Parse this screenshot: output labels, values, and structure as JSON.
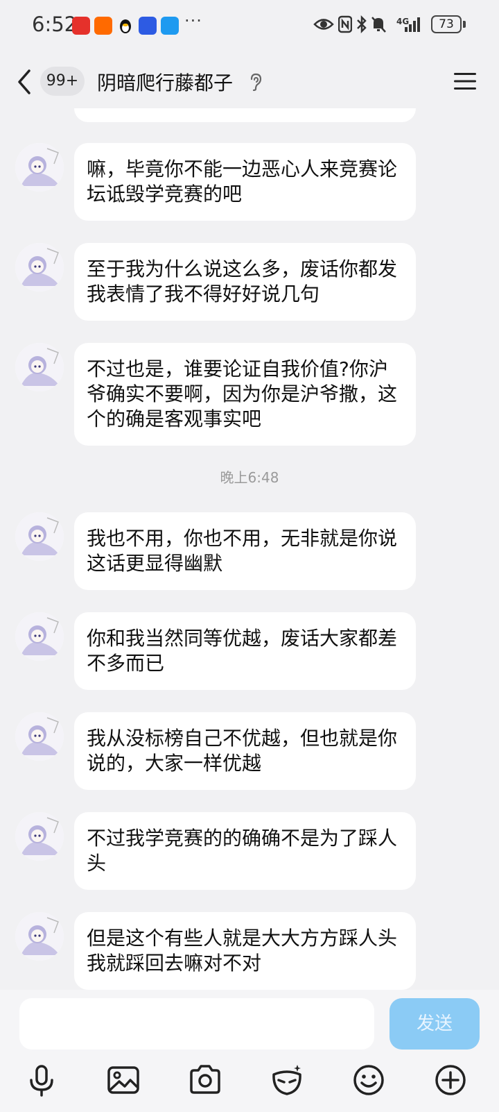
{
  "status_bar": {
    "time": "6:52",
    "network": "4G",
    "battery": "73",
    "more": "···"
  },
  "header": {
    "unread_count": "99+",
    "title": "阴暗爬行藤都子"
  },
  "messages_before": [
    {
      "text": "嘛，毕竟你不能一边恶心人来竞赛论坛诋毁学竞赛的吧"
    },
    {
      "text": "至于我为什么说这么多，废话你都发我表情了我不得好好说几句"
    },
    {
      "text": "不过也是，谁要论证自我价值?你沪爷确实不要啊，因为你是沪爷撒，这个的确是客观事实吧"
    }
  ],
  "timestamp": "晚上6:48",
  "messages_after": [
    {
      "text": "我也不用，你也不用，无非就是你说这话更显得幽默"
    },
    {
      "text": "你和我当然同等优越，废话大家都差不多而已"
    },
    {
      "text": "我从没标榜自己不优越，但也就是你说的，大家一样优越"
    },
    {
      "text": "不过我学竞赛的的确确不是为了踩人头"
    },
    {
      "text": "但是这个有些人就是大大方方踩人头我就踩回去嘛对不对"
    }
  ],
  "composer": {
    "send_label": "发送",
    "input_value": ""
  },
  "colors": {
    "background": "#f1f1f3",
    "bubble": "#ffffff",
    "send_button": "#8bcbf5"
  },
  "toolbar_icons": [
    "microphone-icon",
    "image-icon",
    "camera-icon",
    "sticker-mask-icon",
    "emoji-icon",
    "plus-icon"
  ]
}
